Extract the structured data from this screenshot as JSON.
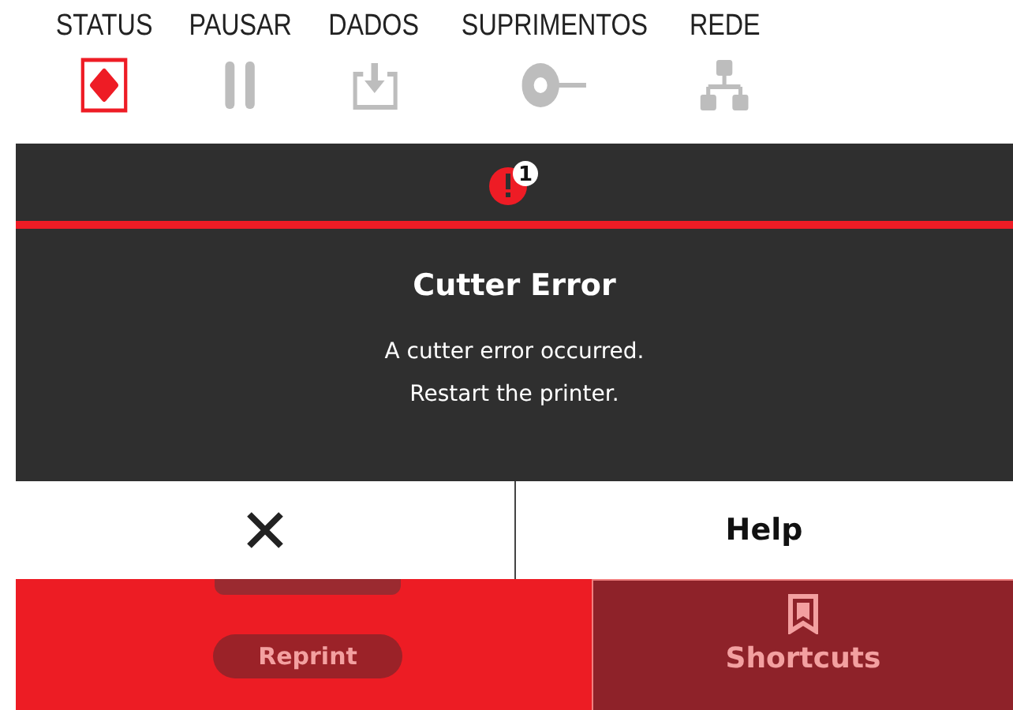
{
  "tabs": [
    {
      "label": "STATUS",
      "kind": "status",
      "selected": true
    },
    {
      "label": "PAUSAR",
      "kind": "pause",
      "selected": false
    },
    {
      "label": "DADOS",
      "kind": "data",
      "selected": false
    },
    {
      "label": "SUPRIMENTOS",
      "kind": "supplies",
      "selected": false
    },
    {
      "label": "REDE",
      "kind": "network",
      "selected": false
    }
  ],
  "screen": {
    "alert_count": "1",
    "dialog": {
      "title": "Cutter Error",
      "message": [
        "A cutter error occurred.",
        "Restart the printer."
      ],
      "help_button": "Help"
    },
    "home": {
      "reprint_button": "Reprint",
      "shortcuts_tile": "Shortcuts"
    }
  }
}
